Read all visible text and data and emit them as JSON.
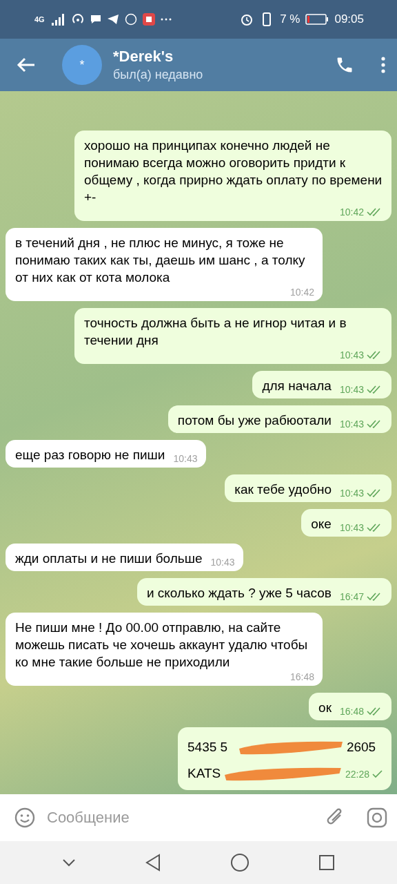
{
  "status_bar": {
    "signal": "4G",
    "battery": "7 %",
    "time": "09:05"
  },
  "header": {
    "avatar": "*",
    "title": "*Derek's",
    "subtitle": "был(а) недавно"
  },
  "messages": [
    {
      "kind": "out",
      "text": "хорошо на принципах конечно людей не понимаю всегда можно оговорить придти к общему , когда прирно ждать оплату по времени +-",
      "time": "10:42",
      "read": true
    },
    {
      "kind": "in",
      "text": "в течений дня , не плюс не минус, я тоже не понимаю таких как ты, даешь им шанс , а толку от них как от кота молока",
      "time": "10:42"
    },
    {
      "kind": "out",
      "text": "точность должна быть а не игнор читая и в течении дня",
      "time": "10:43",
      "read": true
    },
    {
      "kind": "out",
      "text": "для начала",
      "time": "10:43",
      "read": true
    },
    {
      "kind": "out",
      "text": "потом бы уже рабюотали",
      "time": "10:43",
      "read": true
    },
    {
      "kind": "in",
      "text": "еще раз говорю не пиши",
      "time": "10:43"
    },
    {
      "kind": "out",
      "text": "как тебе удобно",
      "time": "10:43",
      "read": true
    },
    {
      "kind": "out",
      "text": "оке",
      "time": "10:43",
      "read": true
    },
    {
      "kind": "in",
      "text": "жди оплаты и не пиши больше",
      "time": "10:43"
    },
    {
      "kind": "out",
      "text": "и сколько ждать ? уже 5 часов",
      "time": "16:47",
      "read": true
    },
    {
      "kind": "in",
      "text": "Не пиши мне ! До 00.00 отправлю, на сайте можешь писать че хочешь аккаунт удалю чтобы ко мне такие больше не приходили",
      "time": "16:48"
    },
    {
      "kind": "out",
      "text": "ок",
      "time": "16:48",
      "read": true
    },
    {
      "kind": "redacted_out",
      "lines": [
        [
          "5435 5",
          "2605"
        ],
        [
          "KATS"
        ]
      ],
      "time": "22:28",
      "read": false
    }
  ],
  "composer": {
    "placeholder": "Сообщение"
  }
}
